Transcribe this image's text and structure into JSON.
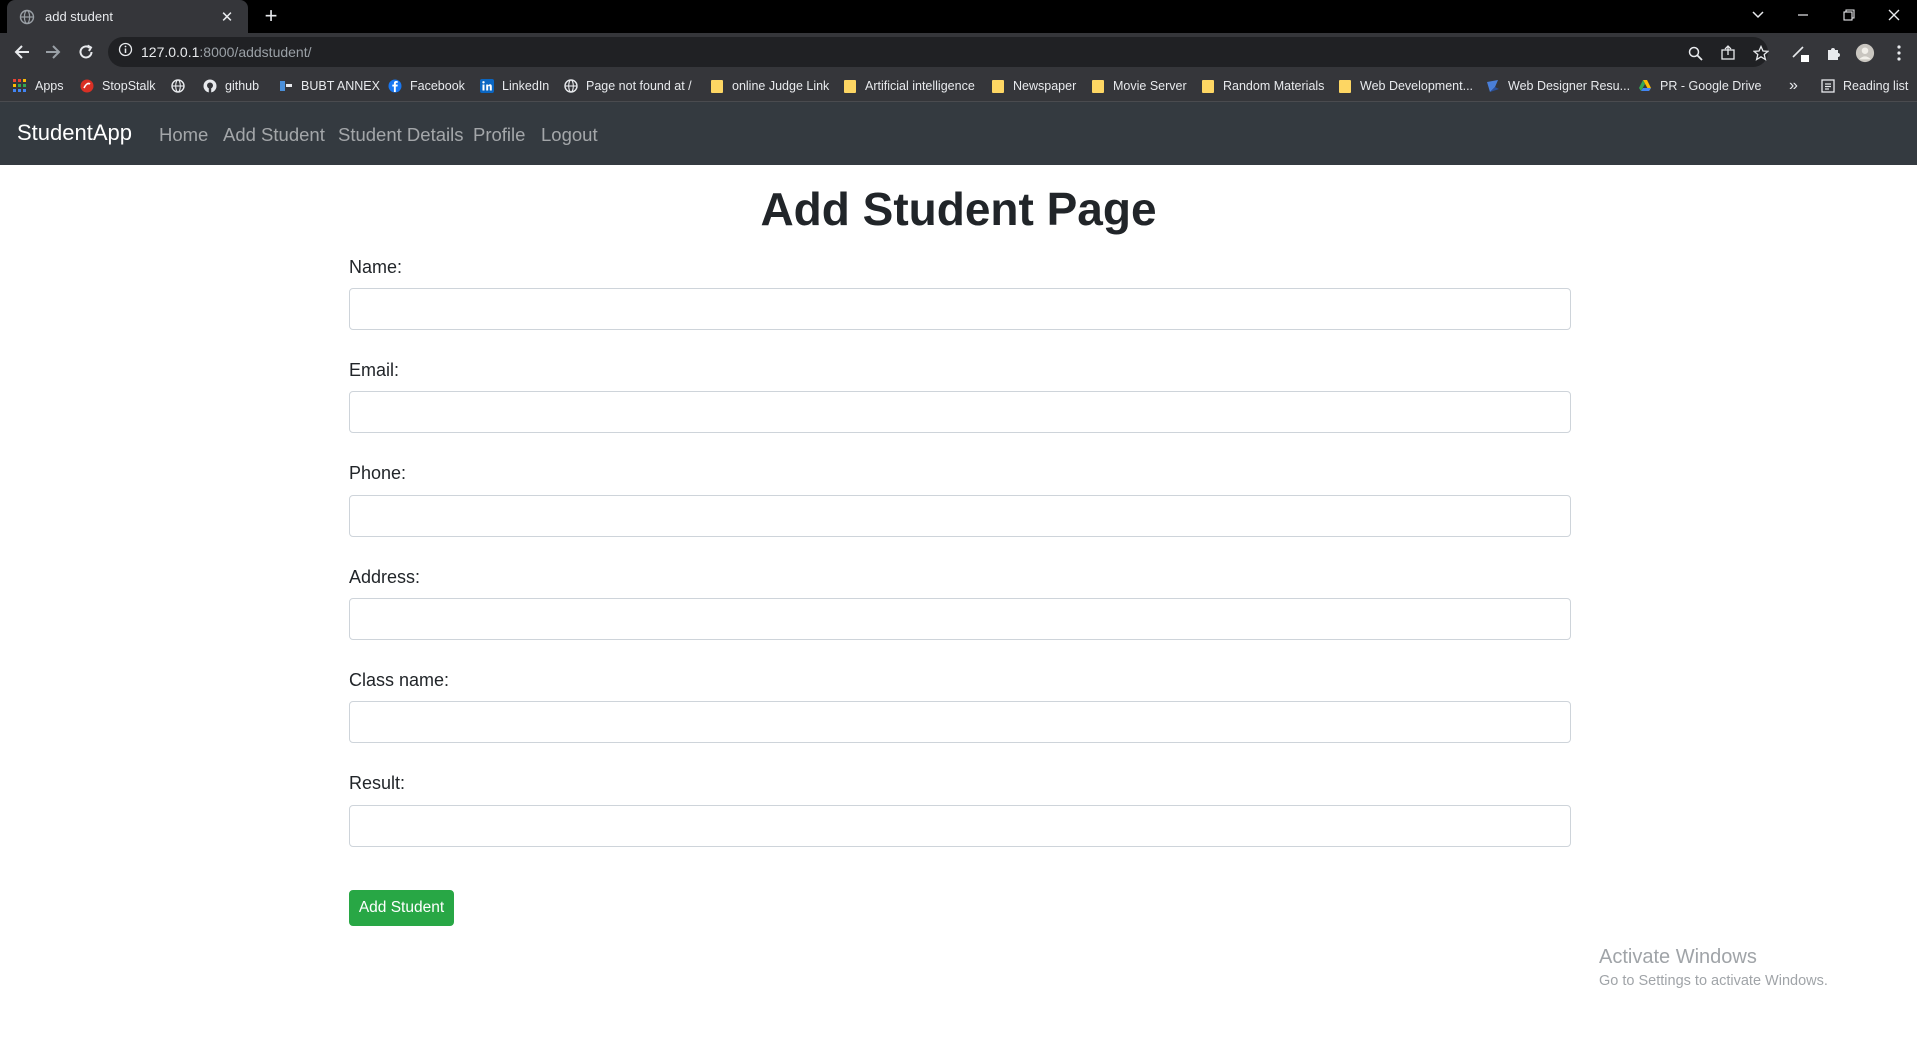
{
  "browser": {
    "tab_title": "add student",
    "url_host": "127.0.0.1",
    "url_path": ":8000/addstudent/",
    "bookmarks": [
      {
        "label": "Apps",
        "icon": "apps-grid-icon"
      },
      {
        "label": "StopStalk",
        "icon": "stopstalk-icon"
      },
      {
        "label": "",
        "icon": "globe-icon"
      },
      {
        "label": "github",
        "icon": "github-icon"
      },
      {
        "label": "BUBT ANNEX",
        "icon": "bubt-icon"
      },
      {
        "label": "Facebook",
        "icon": "facebook-icon"
      },
      {
        "label": "LinkedIn",
        "icon": "linkedin-icon"
      },
      {
        "label": "Page not found at /",
        "icon": "globe-icon"
      },
      {
        "label": "online Judge Link",
        "icon": "folder-icon"
      },
      {
        "label": "Artificial intelligence",
        "icon": "folder-icon"
      },
      {
        "label": "Newspaper",
        "icon": "folder-icon"
      },
      {
        "label": "Movie Server",
        "icon": "folder-icon"
      },
      {
        "label": "Random Materials",
        "icon": "folder-icon"
      },
      {
        "label": "Web Development...",
        "icon": "folder-icon"
      },
      {
        "label": "Web Designer Resu...",
        "icon": "web-designer-icon"
      },
      {
        "label": "PR - Google Drive",
        "icon": "google-drive-icon"
      }
    ],
    "overflow_label": "»",
    "reading_list": "Reading list"
  },
  "navbar": {
    "brand": "StudentApp",
    "links": [
      "Home",
      "Add Student",
      "Student Details",
      "Profile",
      "Logout"
    ]
  },
  "page": {
    "title": "Add Student Page",
    "fields": [
      {
        "label": "Name:",
        "value": ""
      },
      {
        "label": "Email:",
        "value": ""
      },
      {
        "label": "Phone:",
        "value": ""
      },
      {
        "label": "Address:",
        "value": ""
      },
      {
        "label": "Class name:",
        "value": ""
      },
      {
        "label": "Result:",
        "value": ""
      }
    ],
    "submit_label": "Add Student"
  },
  "watermark": {
    "title": "Activate Windows",
    "subtitle": "Go to Settings to activate Windows."
  },
  "colors": {
    "navbar_bg": "#343a40",
    "submit_bg": "#28a745",
    "text": "#212529"
  }
}
